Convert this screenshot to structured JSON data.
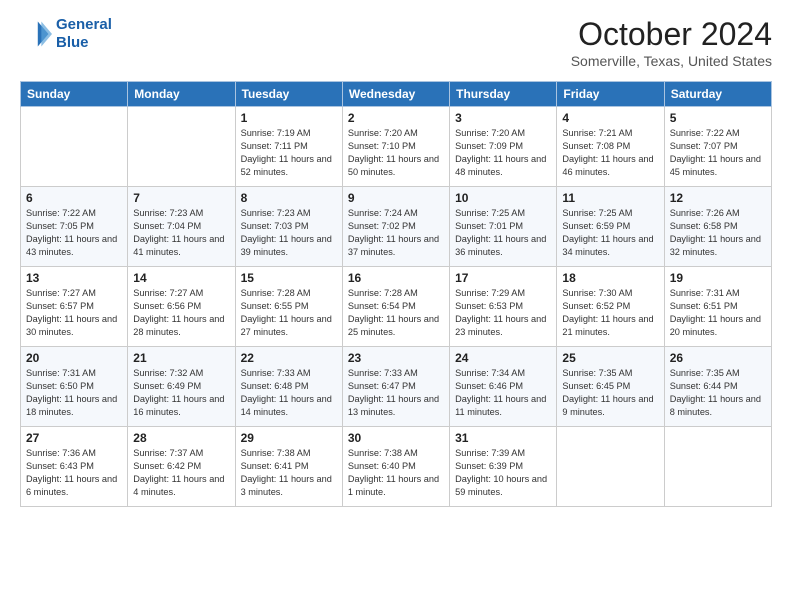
{
  "header": {
    "logo_line1": "General",
    "logo_line2": "Blue",
    "month": "October 2024",
    "location": "Somerville, Texas, United States"
  },
  "weekdays": [
    "Sunday",
    "Monday",
    "Tuesday",
    "Wednesday",
    "Thursday",
    "Friday",
    "Saturday"
  ],
  "weeks": [
    [
      {
        "day": "",
        "text": ""
      },
      {
        "day": "",
        "text": ""
      },
      {
        "day": "1",
        "text": "Sunrise: 7:19 AM\nSunset: 7:11 PM\nDaylight: 11 hours and 52 minutes."
      },
      {
        "day": "2",
        "text": "Sunrise: 7:20 AM\nSunset: 7:10 PM\nDaylight: 11 hours and 50 minutes."
      },
      {
        "day": "3",
        "text": "Sunrise: 7:20 AM\nSunset: 7:09 PM\nDaylight: 11 hours and 48 minutes."
      },
      {
        "day": "4",
        "text": "Sunrise: 7:21 AM\nSunset: 7:08 PM\nDaylight: 11 hours and 46 minutes."
      },
      {
        "day": "5",
        "text": "Sunrise: 7:22 AM\nSunset: 7:07 PM\nDaylight: 11 hours and 45 minutes."
      }
    ],
    [
      {
        "day": "6",
        "text": "Sunrise: 7:22 AM\nSunset: 7:05 PM\nDaylight: 11 hours and 43 minutes."
      },
      {
        "day": "7",
        "text": "Sunrise: 7:23 AM\nSunset: 7:04 PM\nDaylight: 11 hours and 41 minutes."
      },
      {
        "day": "8",
        "text": "Sunrise: 7:23 AM\nSunset: 7:03 PM\nDaylight: 11 hours and 39 minutes."
      },
      {
        "day": "9",
        "text": "Sunrise: 7:24 AM\nSunset: 7:02 PM\nDaylight: 11 hours and 37 minutes."
      },
      {
        "day": "10",
        "text": "Sunrise: 7:25 AM\nSunset: 7:01 PM\nDaylight: 11 hours and 36 minutes."
      },
      {
        "day": "11",
        "text": "Sunrise: 7:25 AM\nSunset: 6:59 PM\nDaylight: 11 hours and 34 minutes."
      },
      {
        "day": "12",
        "text": "Sunrise: 7:26 AM\nSunset: 6:58 PM\nDaylight: 11 hours and 32 minutes."
      }
    ],
    [
      {
        "day": "13",
        "text": "Sunrise: 7:27 AM\nSunset: 6:57 PM\nDaylight: 11 hours and 30 minutes."
      },
      {
        "day": "14",
        "text": "Sunrise: 7:27 AM\nSunset: 6:56 PM\nDaylight: 11 hours and 28 minutes."
      },
      {
        "day": "15",
        "text": "Sunrise: 7:28 AM\nSunset: 6:55 PM\nDaylight: 11 hours and 27 minutes."
      },
      {
        "day": "16",
        "text": "Sunrise: 7:28 AM\nSunset: 6:54 PM\nDaylight: 11 hours and 25 minutes."
      },
      {
        "day": "17",
        "text": "Sunrise: 7:29 AM\nSunset: 6:53 PM\nDaylight: 11 hours and 23 minutes."
      },
      {
        "day": "18",
        "text": "Sunrise: 7:30 AM\nSunset: 6:52 PM\nDaylight: 11 hours and 21 minutes."
      },
      {
        "day": "19",
        "text": "Sunrise: 7:31 AM\nSunset: 6:51 PM\nDaylight: 11 hours and 20 minutes."
      }
    ],
    [
      {
        "day": "20",
        "text": "Sunrise: 7:31 AM\nSunset: 6:50 PM\nDaylight: 11 hours and 18 minutes."
      },
      {
        "day": "21",
        "text": "Sunrise: 7:32 AM\nSunset: 6:49 PM\nDaylight: 11 hours and 16 minutes."
      },
      {
        "day": "22",
        "text": "Sunrise: 7:33 AM\nSunset: 6:48 PM\nDaylight: 11 hours and 14 minutes."
      },
      {
        "day": "23",
        "text": "Sunrise: 7:33 AM\nSunset: 6:47 PM\nDaylight: 11 hours and 13 minutes."
      },
      {
        "day": "24",
        "text": "Sunrise: 7:34 AM\nSunset: 6:46 PM\nDaylight: 11 hours and 11 minutes."
      },
      {
        "day": "25",
        "text": "Sunrise: 7:35 AM\nSunset: 6:45 PM\nDaylight: 11 hours and 9 minutes."
      },
      {
        "day": "26",
        "text": "Sunrise: 7:35 AM\nSunset: 6:44 PM\nDaylight: 11 hours and 8 minutes."
      }
    ],
    [
      {
        "day": "27",
        "text": "Sunrise: 7:36 AM\nSunset: 6:43 PM\nDaylight: 11 hours and 6 minutes."
      },
      {
        "day": "28",
        "text": "Sunrise: 7:37 AM\nSunset: 6:42 PM\nDaylight: 11 hours and 4 minutes."
      },
      {
        "day": "29",
        "text": "Sunrise: 7:38 AM\nSunset: 6:41 PM\nDaylight: 11 hours and 3 minutes."
      },
      {
        "day": "30",
        "text": "Sunrise: 7:38 AM\nSunset: 6:40 PM\nDaylight: 11 hours and 1 minute."
      },
      {
        "day": "31",
        "text": "Sunrise: 7:39 AM\nSunset: 6:39 PM\nDaylight: 10 hours and 59 minutes."
      },
      {
        "day": "",
        "text": ""
      },
      {
        "day": "",
        "text": ""
      }
    ]
  ]
}
